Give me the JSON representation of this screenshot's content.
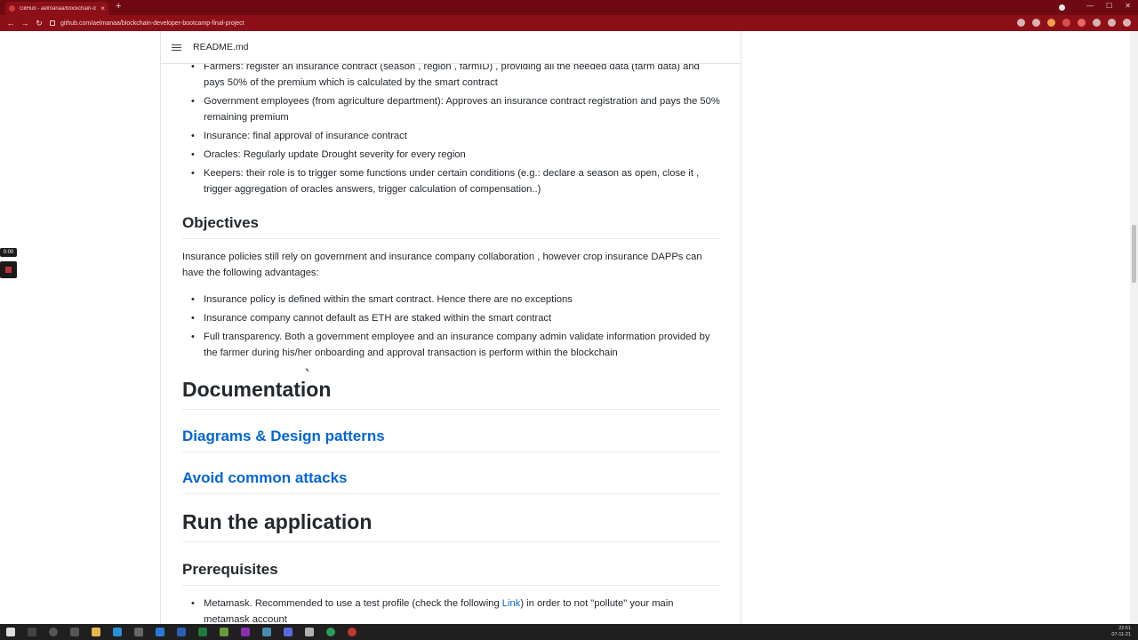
{
  "browser": {
    "tab_title": "GitHub - aelmanaa/blockchain-d",
    "tab_close": "×",
    "new_tab": "+",
    "url": "github.com/aelmanaa/blockchain-developer-bootcamp-final-project",
    "back": "←",
    "forward": "→",
    "reload": "↻"
  },
  "readme": {
    "header": "README.md",
    "roles": [
      "Farmers: register an insurance contract (season , region , farmID) , providing all the needed data (farm data) and pays 50% of the premium which is calculated by the smart contract",
      "Government employees (from agriculture department): Approves an insurance contract registration and pays the 50% remaining premium",
      "Insurance: final approval of insurance contract",
      "Oracles: Regularly update Drought severity for every region",
      "Keepers: their role is to trigger some functions under certain conditions (e.g.: declare a season as open, close it , trigger aggregation of oracles answers, trigger calculation of compensation..)"
    ],
    "objectives_heading": "Objectives",
    "objectives_intro": "Insurance policies still rely on government and insurance company collaboration , however crop insurance DAPPs can have the following advantages:",
    "advantages": [
      "Insurance policy is defined within the smart contract. Hence there are no exceptions",
      "Insurance company cannot default as ETH are staked within the smart contract",
      "Full transparency. Both a government employee and an insurance company admin validate information provided by the farmer during his/her onboarding and approval transaction is perform within the blockchain"
    ],
    "documentation_heading": "Documentation",
    "diagrams_link": "Diagrams & Design patterns",
    "attacks_link": "Avoid common attacks",
    "run_heading": "Run the application",
    "prerequisites_heading": "Prerequisites",
    "metamask_pre": "Metamask. Recommended to use a test profile (check the following ",
    "metamask_link": "Link",
    "metamask_post": ") in order to not \"pollute\" your main metamask account"
  },
  "overlay": {
    "timer": "0:00"
  },
  "taskbar": {
    "time": "22:51",
    "date": "07-11-21"
  },
  "colors": {
    "chrome_dark": "#6f0a12",
    "chrome": "#8d1019",
    "link": "#0366d6",
    "text": "#24292e"
  }
}
